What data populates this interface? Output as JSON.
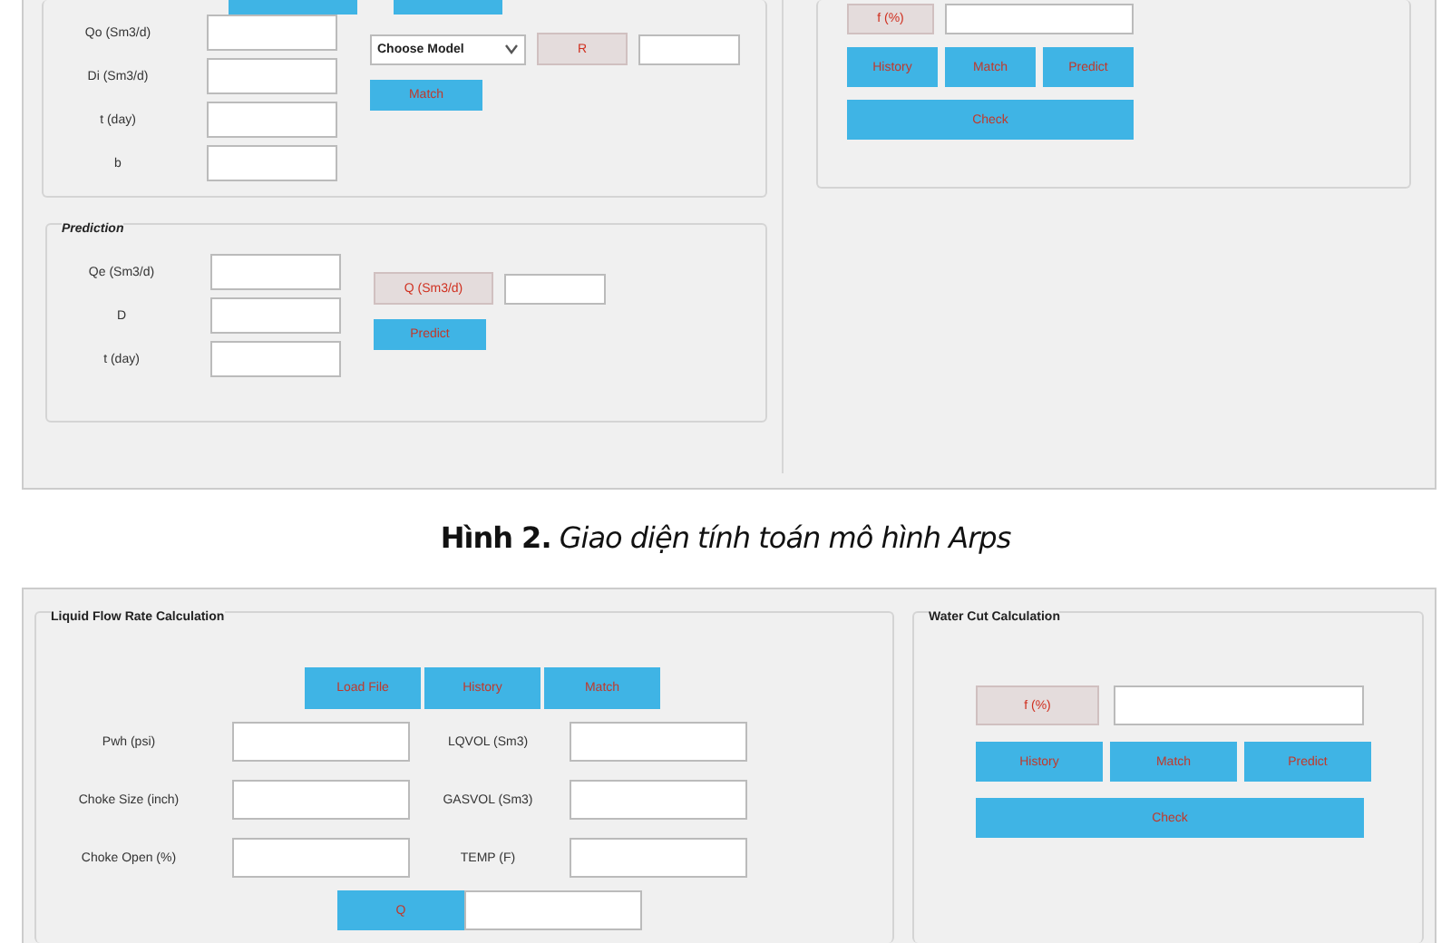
{
  "arps_figure": {
    "fit_panel": {
      "fields": [
        {
          "label": "Qo (Sm3/d)"
        },
        {
          "label": "Di (Sm3/d)"
        },
        {
          "label": "t (day)"
        },
        {
          "label": "b"
        }
      ],
      "model_select": "Choose Model",
      "r_label": "R",
      "match_button": "Match"
    },
    "prediction_panel": {
      "title": "Prediction",
      "fields": [
        {
          "label": "Qe (Sm3/d)"
        },
        {
          "label": "D"
        },
        {
          "label": "t (day)"
        }
      ],
      "output_label": "Q (Sm3/d)",
      "predict_button": "Predict"
    },
    "water_cut_panel": {
      "output_label": "f (%)",
      "buttons": [
        "History",
        "Match",
        "Predict"
      ],
      "check_button": "Check"
    }
  },
  "caption": "**Hình 2.** *Giao diện tính toán mô hình Arps*",
  "flow_figure": {
    "liquid_panel": {
      "title": "Liquid Flow Rate Calculation",
      "buttons": [
        "Load File",
        "History",
        "Match"
      ],
      "left_fields": [
        {
          "label": "Pwh (psi)"
        },
        {
          "label": "Choke Size (inch)"
        },
        {
          "label": "Choke Open (%)"
        }
      ],
      "right_fields": [
        {
          "label": "LQVOL (Sm3)"
        },
        {
          "label": "GASVOL (Sm3)"
        },
        {
          "label": "TEMP (F)"
        }
      ],
      "q_button": "Q"
    },
    "water_cut_panel": {
      "title": "Water Cut Calculation",
      "output_label": "f (%)",
      "buttons": [
        "History",
        "Match",
        "Predict"
      ],
      "check_button": "Check"
    }
  }
}
